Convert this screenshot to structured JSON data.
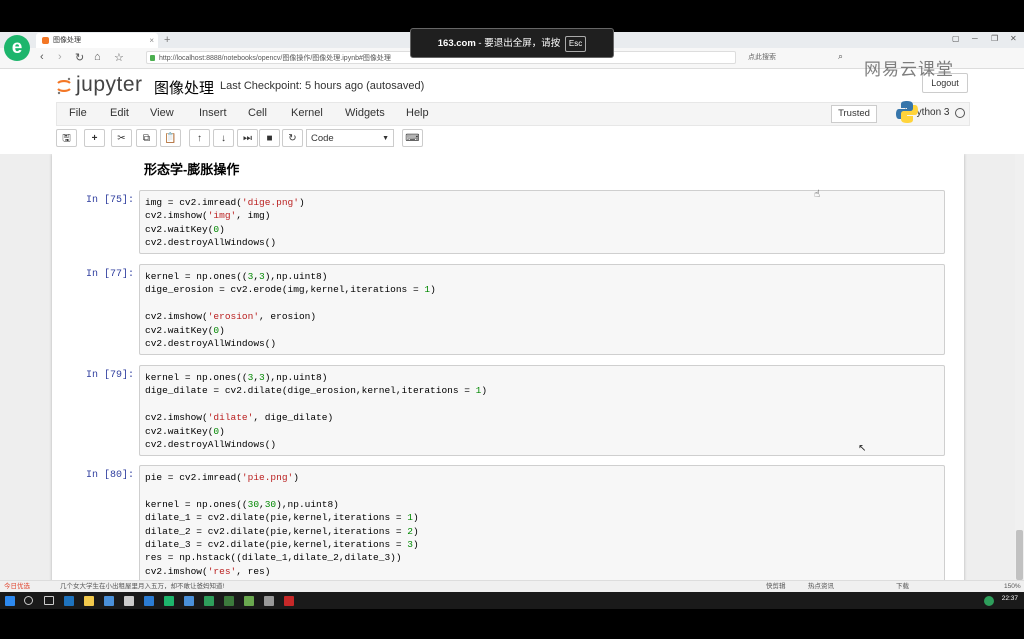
{
  "overlay": {
    "esc_site": "163.com",
    "esc_message": " - 要退出全屏，请按",
    "esc_key": "Esc",
    "watermark": "网易云课堂"
  },
  "browser": {
    "logo_letter": "e",
    "tab_title": "图像处理",
    "new_tab": "+",
    "url": "http://localhost:8888/notebooks/opencv/图像操作/图像处理.ipynb#图像处理",
    "search_placeholder": "点此搜索"
  },
  "jupyter": {
    "logo_text": "jupyter",
    "notebook_name": "图像处理",
    "checkpoint": "Last Checkpoint: 5 hours ago (autosaved)",
    "logout": "Logout",
    "menus": [
      "File",
      "Edit",
      "View",
      "Insert",
      "Cell",
      "Kernel",
      "Widgets",
      "Help"
    ],
    "trusted": "Trusted",
    "kernel_name": "Python 3",
    "cell_type": "Code"
  },
  "toolbar_icons": [
    "save-icon",
    "add-cell-icon",
    "cut-icon",
    "copy-icon",
    "paste-icon",
    "move-up-icon",
    "move-down-icon",
    "run-icon",
    "stop-icon",
    "restart-icon",
    "keyboard-icon"
  ],
  "notebook": {
    "heading": "形态学-膨胀操作",
    "cells": [
      {
        "prompt": "In [75]:",
        "lines": [
          "img = cv2.imread('dige.png')",
          "cv2.imshow('img', img)",
          "cv2.waitKey(0)",
          "cv2.destroyAllWindows()"
        ]
      },
      {
        "prompt": "In [77]:",
        "lines": [
          "kernel = np.ones((3,3),np.uint8)",
          "dige_erosion = cv2.erode(img,kernel,iterations = 1)",
          "",
          "cv2.imshow('erosion', erosion)",
          "cv2.waitKey(0)",
          "cv2.destroyAllWindows()"
        ]
      },
      {
        "prompt": "In [79]:",
        "lines": [
          "kernel = np.ones((3,3),np.uint8)",
          "dige_dilate = cv2.dilate(dige_erosion,kernel,iterations = 1)",
          "",
          "cv2.imshow('dilate', dige_dilate)",
          "cv2.waitKey(0)",
          "cv2.destroyAllWindows()"
        ]
      },
      {
        "prompt": "In [80]:",
        "lines": [
          "pie = cv2.imread('pie.png')",
          "",
          "kernel = np.ones((30,30),np.uint8)",
          "dilate_1 = cv2.dilate(pie,kernel,iterations = 1)",
          "dilate_2 = cv2.dilate(pie,kernel,iterations = 2)",
          "dilate_3 = cv2.dilate(pie,kernel,iterations = 3)",
          "res = np.hstack((dilate_1,dilate_2,dilate_3))",
          "cv2.imshow('res', res)"
        ]
      }
    ]
  },
  "statusbar": {
    "left": "今日优选",
    "news": "几个女大学生在小出租屋里月入五万，却不敢让爸妈知道!",
    "right_items": [
      "快剪辑",
      "热点资讯",
      "下载",
      "150%"
    ]
  },
  "taskbar": {
    "clock": "22:37"
  }
}
